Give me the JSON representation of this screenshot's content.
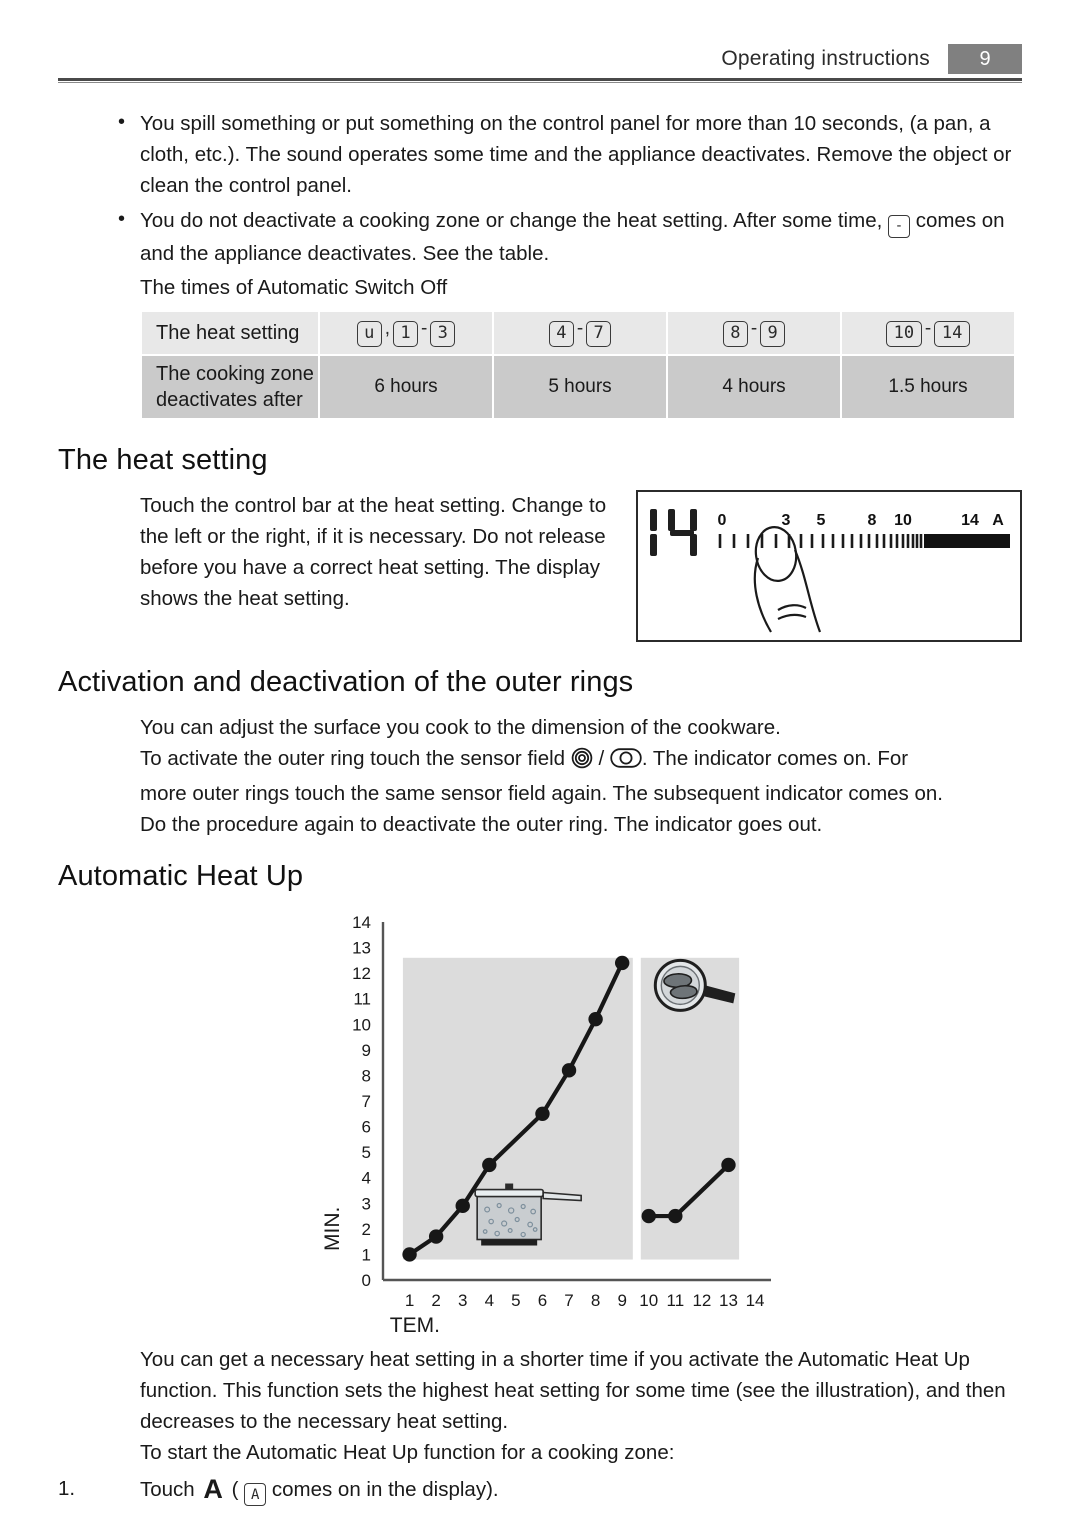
{
  "header": {
    "title": "Operating instructions",
    "page_number": "9"
  },
  "bullets": [
    "You spill something or put something on the control panel for more than 10 seconds, (a pan, a cloth, etc.). The sound operates some time and the appliance deactivates. Remove the object or clean the control panel.",
    "You do not deactivate a cooking zone or change the heat setting. After some time,   comes on and the appliance deactivates. See the table."
  ],
  "bullet2_parts": {
    "before": "You do not deactivate a cooking zone or change the heat setting. After some time,",
    "icon": "-",
    "after": "comes on and the appliance deactivates. See the table."
  },
  "table": {
    "caption": "The times of Automatic Switch Off",
    "row1_label": "The heat setting",
    "row2_label_line1": "The cooking zone",
    "row2_label_line2": "deactivates after",
    "heat_settings": [
      {
        "a": "u",
        "sep": ",",
        "b": "1",
        "dash": "-",
        "c": "3"
      },
      {
        "a": "4",
        "dash": "-",
        "c": "7"
      },
      {
        "a": "8",
        "dash": "-",
        "c": "9"
      },
      {
        "a": "10",
        "dash": "-",
        "c": "14"
      }
    ],
    "times": [
      "6 hours",
      "5 hours",
      "4 hours",
      "1.5 hours"
    ]
  },
  "heat_setting_section": {
    "title": "The heat setting",
    "body": "Touch the control bar at the heat setting. Change to the left or the right, if it is necessary. Do not release before you have a correct heat setting. The display shows the heat setting.",
    "display_value": "14",
    "scale_labels": [
      "0",
      "3",
      "5",
      "8",
      "10",
      "14",
      "A"
    ]
  },
  "outer_rings_section": {
    "title": "Activation and deactivation of the outer rings",
    "line1": "You can adjust the surface you cook to the dimension of the cookware.",
    "line2_before": "To activate the outer ring touch the sensor field",
    "line2_sep": "/",
    "line2_after": ". The indicator comes on. For",
    "line3": "more outer rings touch the same sensor field again. The subsequent indicator comes on.",
    "line4": "Do the procedure again to deactivate the outer ring. The indicator goes out.",
    "icon1": "concentric-rings-sensor-icon",
    "icon2": "oval-ring-sensor-icon"
  },
  "automatic_heat_up_section": {
    "title": "Automatic Heat Up",
    "para1": "You can get a necessary heat setting in a shorter time if you activate the Automatic Heat Up function. This function sets the highest heat setting for some time (see the illustration), and then decreases to the necessary heat setting.",
    "para2": "To start the Automatic Heat Up function for a cooking zone:",
    "step1_number": "1.",
    "step1_before": "Touch",
    "step1_key": "A",
    "step1_paren_open": "(",
    "step1_display": "A",
    "step1_after": "comes on in the display)."
  },
  "chart_data": {
    "type": "line",
    "title": "",
    "xlabel": "TEM.",
    "ylabel": "MIN.",
    "xlim": [
      0,
      14.6
    ],
    "ylim": [
      0,
      14
    ],
    "xticks": [
      "1",
      "2",
      "3",
      "4",
      "5",
      "6",
      "7",
      "8",
      "9",
      "10",
      "11",
      "12",
      "13",
      "14"
    ],
    "yticks": [
      "0",
      "1",
      "2",
      "3",
      "4",
      "5",
      "6",
      "7",
      "8",
      "9",
      "10",
      "11",
      "12",
      "13",
      "14"
    ],
    "grid": false,
    "legend": "none",
    "series": [
      {
        "name": "pot-boiling",
        "x": [
          1,
          2,
          3,
          4,
          6,
          7,
          8,
          9
        ],
        "y": [
          1.0,
          1.7,
          2.9,
          4.5,
          6.5,
          8.2,
          10.2,
          12.4
        ]
      },
      {
        "name": "pan-frying",
        "x": [
          10,
          11,
          13
        ],
        "y": [
          2.5,
          2.5,
          4.5
        ]
      }
    ],
    "panels": [
      {
        "name": "boiling-panel",
        "x_range": [
          0.75,
          9.4
        ],
        "y_range": [
          0.8,
          12.6
        ]
      },
      {
        "name": "frying-panel",
        "x_range": [
          9.7,
          13.4
        ],
        "y_range": [
          0.8,
          12.6
        ]
      }
    ],
    "annotations": [
      {
        "name": "pot-icon",
        "x": 5.5,
        "y": 2.6
      },
      {
        "name": "frying-pan-icon",
        "x": 11.3,
        "y": 11.6
      }
    ]
  },
  "colors": {
    "page_number_bg": "#808080",
    "table_row1_bg": "#e8e8e8",
    "table_row2_bg": "#cacaca",
    "chart_panel_bg": "#dcdcdc",
    "ink": "#1a1a1a"
  }
}
